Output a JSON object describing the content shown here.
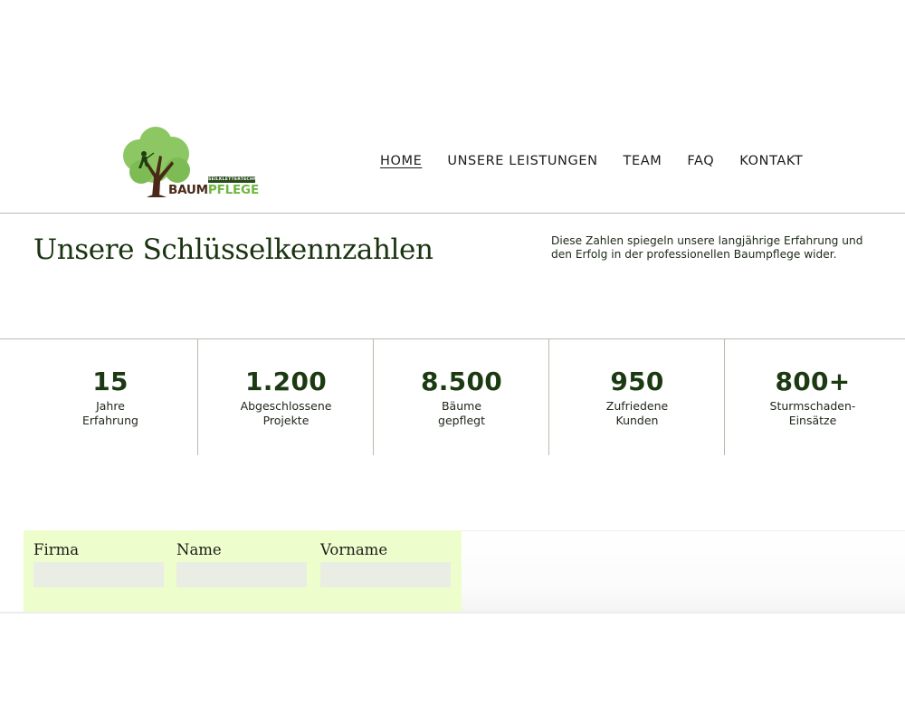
{
  "brand": {
    "tagline": "SEILKLETTERTECHNIK",
    "name_part1": "BAUM",
    "name_part2": "PFLEGE"
  },
  "nav": {
    "items": [
      {
        "label": "HOME",
        "active": true
      },
      {
        "label": "UNSERE LEISTUNGEN",
        "active": false
      },
      {
        "label": "TEAM",
        "active": false
      },
      {
        "label": "FAQ",
        "active": false
      },
      {
        "label": "KONTAKT",
        "active": false
      }
    ]
  },
  "key_figures": {
    "title": "Unsere Schlüsselkennzahlen",
    "description": "Diese Zahlen spiegeln unsere langjährige Erfahrung und den Erfolg in der professionellen Baumpflege wider.",
    "stats": [
      {
        "value": "15",
        "label": "Jahre\nErfahrung"
      },
      {
        "value": "1.200",
        "label": "Abgeschlossene\nProjekte"
      },
      {
        "value": "8.500",
        "label": "Bäume\ngepflegt"
      },
      {
        "value": "950",
        "label": "Zufriedene\nKunden"
      },
      {
        "value": "800+",
        "label": "Sturmschaden-\nEinsätze"
      }
    ]
  },
  "form": {
    "fields": [
      {
        "label": "Firma",
        "value": ""
      },
      {
        "label": "Name",
        "value": ""
      },
      {
        "label": "Vorname",
        "value": ""
      }
    ]
  },
  "colors": {
    "brand_dark_green": "#1a3310",
    "brand_light_green": "#6fb742",
    "brand_brown": "#4a2a17",
    "form_background": "#eefdcc",
    "input_background": "#e9ede3",
    "divider": "#b9b9b0"
  },
  "icons": {
    "logo": "tree-with-climber-icon"
  }
}
